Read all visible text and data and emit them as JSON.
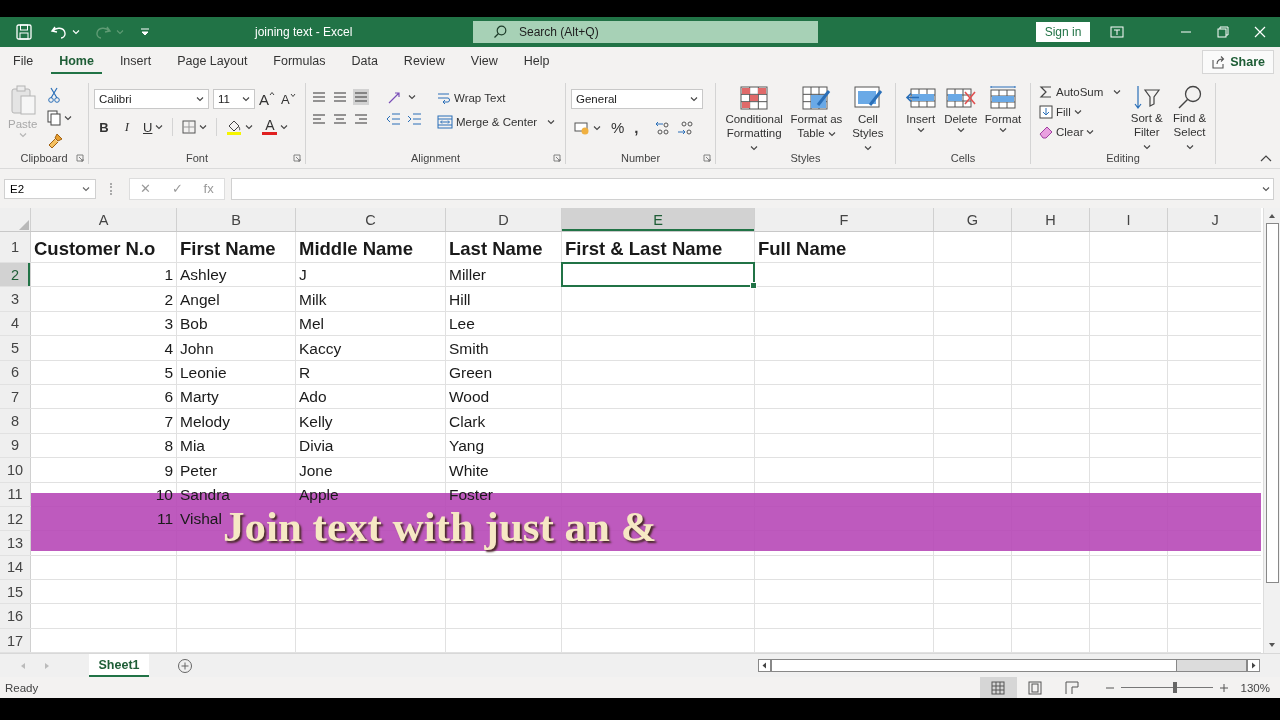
{
  "title_bar": {
    "title": "joining text  -  Excel",
    "search": {
      "placeholder": "Search (Alt+Q)"
    },
    "sign_in": "Sign in"
  },
  "menu_tabs": [
    {
      "label": "File",
      "selected": false
    },
    {
      "label": "Home",
      "selected": true
    },
    {
      "label": "Insert",
      "selected": false
    },
    {
      "label": "Page Layout",
      "selected": false
    },
    {
      "label": "Formulas",
      "selected": false
    },
    {
      "label": "Data",
      "selected": false
    },
    {
      "label": "Review",
      "selected": false
    },
    {
      "label": "View",
      "selected": false
    },
    {
      "label": "Help",
      "selected": false
    }
  ],
  "share": "Share",
  "ribbon": {
    "clipboard": {
      "label": "Clipboard",
      "paste": {
        "label": "Paste",
        "disabled": true
      }
    },
    "font": {
      "label": "Font",
      "font_name": "Calibri",
      "font_size": "11",
      "grow": "A",
      "shrink": "A",
      "bold": "B",
      "italic": "I",
      "underline": "U",
      "font_color": "A"
    },
    "alignment": {
      "label": "Alignment",
      "wrap_text": "Wrap Text",
      "merge_center": "Merge & Center"
    },
    "number": {
      "label": "Number",
      "format": "General",
      "percent": "%",
      "comma": ","
    },
    "styles": {
      "label": "Styles",
      "buttons": [
        "Conditional Formatting",
        "Format as Table",
        "Cell Styles"
      ]
    },
    "cells": {
      "label": "Cells",
      "buttons": [
        "Insert",
        "Delete",
        "Format"
      ]
    },
    "editing": {
      "label": "Editing",
      "autosum": "AutoSum",
      "fill": "Fill",
      "clear": "Clear",
      "buttons": [
        "Sort & Filter",
        "Find & Select"
      ]
    }
  },
  "formula_bar": {
    "name_box": "E2",
    "cancel": "✕",
    "enter": "✓",
    "function": "fx"
  },
  "columns": [
    {
      "label": "A",
      "selected": false
    },
    {
      "label": "B",
      "selected": false
    },
    {
      "label": "C",
      "selected": false
    },
    {
      "label": "D",
      "selected": false
    },
    {
      "label": "E",
      "selected": true
    },
    {
      "label": "F",
      "selected": false
    },
    {
      "label": "G",
      "selected": false
    },
    {
      "label": "H",
      "selected": false
    },
    {
      "label": "I",
      "selected": false
    },
    {
      "label": "J",
      "selected": false
    }
  ],
  "rows": [
    {
      "number": "1",
      "selected": false,
      "header": true,
      "cells": [
        "Customer N.o",
        "First Name",
        "Middle Name",
        "Last Name",
        "First & Last Name",
        "Full Name"
      ]
    },
    {
      "number": "2",
      "selected": true,
      "header": false,
      "cells": [
        "1",
        "Ashley",
        "J",
        "Miller"
      ]
    },
    {
      "number": "3",
      "selected": false,
      "header": false,
      "cells": [
        "2",
        "Angel",
        "Milk",
        "Hill"
      ]
    },
    {
      "number": "4",
      "selected": false,
      "header": false,
      "cells": [
        "3",
        "Bob",
        "Mel",
        "Lee"
      ]
    },
    {
      "number": "5",
      "selected": false,
      "header": false,
      "cells": [
        "4",
        "John",
        "Kaccy",
        "Smith"
      ]
    },
    {
      "number": "6",
      "selected": false,
      "header": false,
      "cells": [
        "5",
        "Leonie",
        "R",
        "Green"
      ]
    },
    {
      "number": "7",
      "selected": false,
      "header": false,
      "cells": [
        "6",
        "Marty",
        "Ado",
        "Wood"
      ]
    },
    {
      "number": "8",
      "selected": false,
      "header": false,
      "cells": [
        "7",
        "Melody",
        "Kelly",
        "Clark"
      ]
    },
    {
      "number": "9",
      "selected": false,
      "header": false,
      "cells": [
        "8",
        "Mia",
        "Divia",
        "Yang"
      ]
    },
    {
      "number": "10",
      "selected": false,
      "header": false,
      "cells": [
        "9",
        "Peter",
        "Jone",
        "White"
      ]
    },
    {
      "number": "11",
      "selected": false,
      "header": false,
      "cells": [
        "10",
        "Sandra",
        "Apple",
        "Foster"
      ]
    },
    {
      "number": "12",
      "selected": false,
      "header": false,
      "cells": [
        "11",
        "Vishal"
      ]
    },
    {
      "number": "13",
      "selected": false,
      "header": false,
      "cells": []
    },
    {
      "number": "14",
      "selected": false,
      "header": false,
      "cells": []
    },
    {
      "number": "15",
      "selected": false,
      "header": false,
      "cells": []
    },
    {
      "number": "16",
      "selected": false,
      "header": false,
      "cells": []
    },
    {
      "number": "17",
      "selected": false,
      "header": false,
      "cells": []
    }
  ],
  "caption": "Join text with just an &",
  "sheet_tabs": [
    {
      "label": "Sheet1",
      "selected": true
    }
  ],
  "status_bar": {
    "status": "Ready",
    "views": [
      {
        "kind": "normal",
        "selected": true
      },
      {
        "kind": "page_layout",
        "selected": false
      },
      {
        "kind": "page_break",
        "selected": false
      }
    ],
    "zoom": {
      "level": 0.59,
      "reading": "130%"
    }
  }
}
